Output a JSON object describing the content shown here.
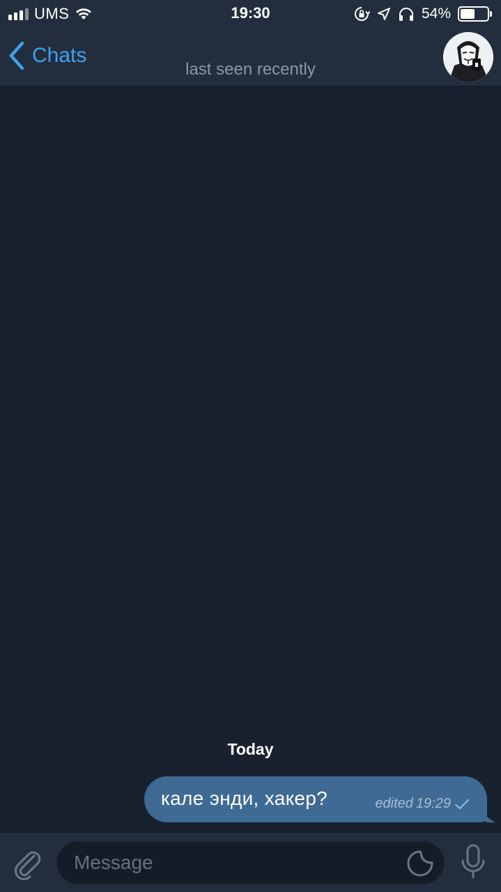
{
  "status_bar": {
    "carrier": "UMS",
    "time": "19:30",
    "battery_percent": "54%",
    "battery_level": 0.54,
    "signal_bars": 4,
    "icons": [
      "signal-icon",
      "wifi-icon",
      "rotation-lock-icon",
      "location-icon",
      "headphones-icon",
      "battery-icon"
    ]
  },
  "nav": {
    "back_label": "Chats",
    "subtitle": "last seen recently",
    "accent_color": "#3fa0ee"
  },
  "chat": {
    "date_separator": "Today",
    "messages": [
      {
        "text": "кале энди, хакер?",
        "edited": "edited",
        "time": "19:29",
        "outgoing": true,
        "status": "sent",
        "bubble_color": "#3e6a94"
      }
    ]
  },
  "input": {
    "placeholder": "Message",
    "value": ""
  },
  "colors": {
    "background": "#18212d",
    "bar": "#222e3d",
    "secondary_text": "#8d97a5"
  }
}
